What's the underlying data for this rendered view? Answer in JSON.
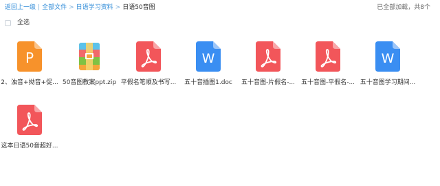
{
  "breadcrumb": {
    "back": "返回上一级",
    "all_files": "全部文件",
    "folder": "日语学习资料",
    "current": "日语50音图"
  },
  "status": "已全部加载，共8个",
  "select_all": "全选",
  "files": [
    {
      "name": "2、浊音+拗音+促...",
      "type": "ppt",
      "icon_letter": "P"
    },
    {
      "name": "50音图教案ppt.zip",
      "type": "zip",
      "icon_letter": ""
    },
    {
      "name": "平假名笔顺及书写...",
      "type": "pdf",
      "icon_letter": ""
    },
    {
      "name": "五十音插图1.doc",
      "type": "doc",
      "icon_letter": "W"
    },
    {
      "name": "五十音图-片假名-...",
      "type": "pdf",
      "icon_letter": ""
    },
    {
      "name": "五十音图-平假名-...",
      "type": "pdf",
      "icon_letter": ""
    },
    {
      "name": "五十音图学习期间...",
      "type": "doc",
      "icon_letter": "W"
    },
    {
      "name": "这本日语50音超好...",
      "type": "pdf",
      "icon_letter": ""
    }
  ],
  "colors": {
    "link": "#2f8bd8",
    "ppt": "#f7922b",
    "pdf": "#f2565a",
    "doc": "#3a8ef2",
    "zip_top": "#5cc2ea"
  }
}
